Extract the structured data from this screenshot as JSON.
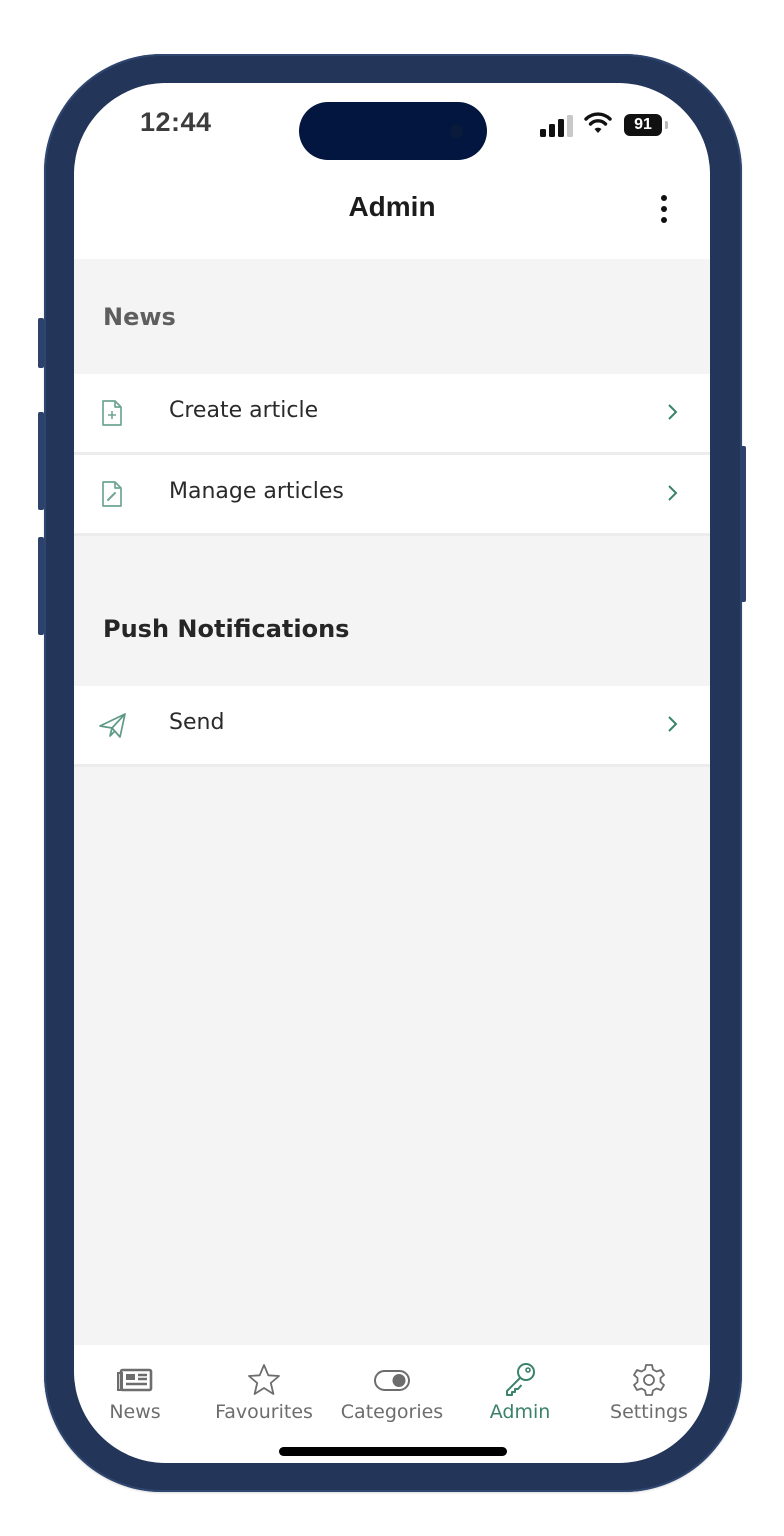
{
  "status_bar": {
    "time": "12:44",
    "battery": "91",
    "signal_icon": "cellular-signal-icon",
    "wifi_icon": "wifi-icon",
    "battery_icon": "battery-icon"
  },
  "nav": {
    "title": "Admin",
    "more_icon": "more-vertical-icon"
  },
  "sections": [
    {
      "title": "News",
      "items": [
        {
          "label": "Create article",
          "icon": "file-plus-icon"
        },
        {
          "label": "Manage articles",
          "icon": "file-edit-icon"
        }
      ]
    },
    {
      "title": "Push Notifications",
      "items": [
        {
          "label": "Send",
          "icon": "send-icon"
        }
      ]
    }
  ],
  "tabbar": {
    "active": "Admin",
    "items": [
      {
        "label": "News",
        "icon": "newspaper-icon"
      },
      {
        "label": "Favourites",
        "icon": "star-icon"
      },
      {
        "label": "Categories",
        "icon": "toggle-icon"
      },
      {
        "label": "Admin",
        "icon": "key-icon"
      },
      {
        "label": "Settings",
        "icon": "gear-icon"
      }
    ]
  },
  "colors": {
    "accent": "#3a8268",
    "frame": "#233659",
    "island": "#031640",
    "background": "#f4f4f4",
    "section_news_title": "#5e5e5e",
    "section_push_title": "#262626",
    "tab_inactive": "#6d6d6d"
  }
}
